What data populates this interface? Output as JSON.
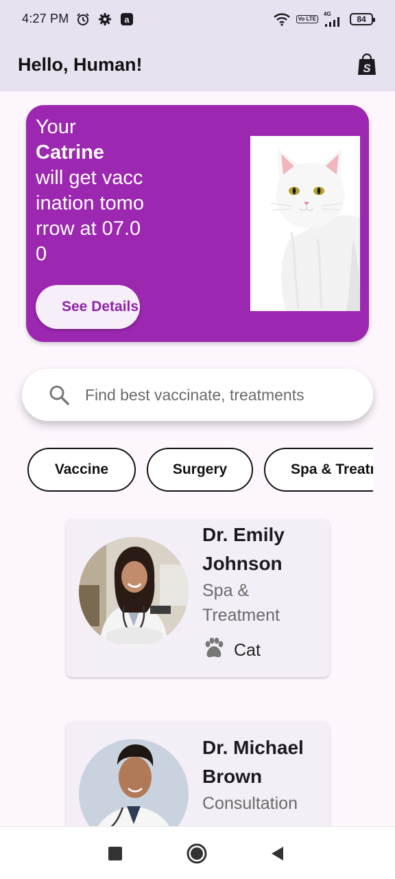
{
  "status_bar": {
    "time": "4:27 PM",
    "battery": "84",
    "network": "4G",
    "volte": "Vo LTE",
    "icons": [
      "alarm-icon",
      "gear-icon",
      "app-a-icon",
      "wifi-icon",
      "signal-icon",
      "battery-icon"
    ]
  },
  "app_bar": {
    "title": "Hello, Human!",
    "action_icon": "shopping-bag-icon"
  },
  "banner": {
    "line1": "Your",
    "pet_name": "Catrine",
    "line2": "will get vaccination tomorrow at 07.00",
    "button_label": "See Details",
    "image": "white-cat"
  },
  "search": {
    "placeholder": "Find best vaccinate, treatments"
  },
  "categories": [
    {
      "label": "Vaccine"
    },
    {
      "label": "Surgery"
    },
    {
      "label": "Spa & Treatment"
    }
  ],
  "doctors": [
    {
      "name": "Dr. Emily Johnson",
      "specialty": "Spa & Treatment",
      "pet": "Cat",
      "pet_icon": "paw-icon"
    },
    {
      "name": "Dr. Michael Brown",
      "specialty": "Consultation"
    }
  ],
  "nav": {
    "icons": [
      "recents-square-icon",
      "home-circle-icon",
      "back-triangle-icon"
    ]
  },
  "colors": {
    "primary": "#9C27B0",
    "app_bar_bg": "#E8E1EF",
    "page_bg": "#FDF6FD",
    "card_bg": "#F4EFF6"
  }
}
